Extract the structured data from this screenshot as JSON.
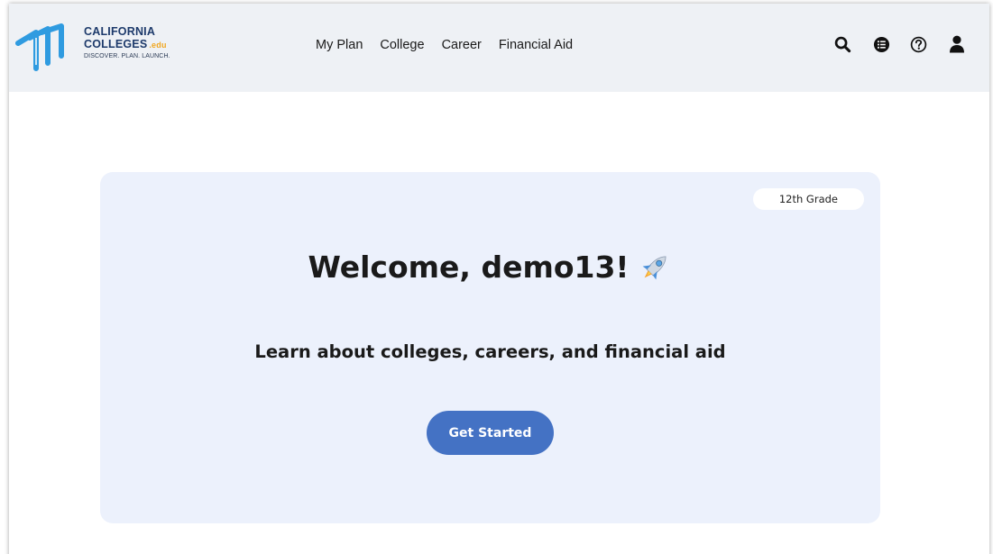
{
  "brand": {
    "line1": "CALIFORNIA",
    "line2": "COLLEGES",
    "edu": ".edu",
    "tagline": "DISCOVER. PLAN. LAUNCH.",
    "primary_color": "#1d3a6b",
    "mark_color": "#2f9be0",
    "edu_color": "#f0a61e"
  },
  "nav": {
    "items": [
      {
        "label": "My Plan"
      },
      {
        "label": "College"
      },
      {
        "label": "Career"
      },
      {
        "label": "Financial Aid"
      }
    ]
  },
  "header_icons": [
    "search-icon",
    "list-icon",
    "help-icon",
    "user-icon"
  ],
  "hero": {
    "grade_badge": "12th Grade",
    "welcome": "Welcome, demo13!",
    "emoji": "rocket-icon",
    "subtitle": "Learn about colleges, careers, and financial aid",
    "cta_label": "Get Started",
    "card_color": "#ecf1fc",
    "cta_color": "#4472c4"
  }
}
